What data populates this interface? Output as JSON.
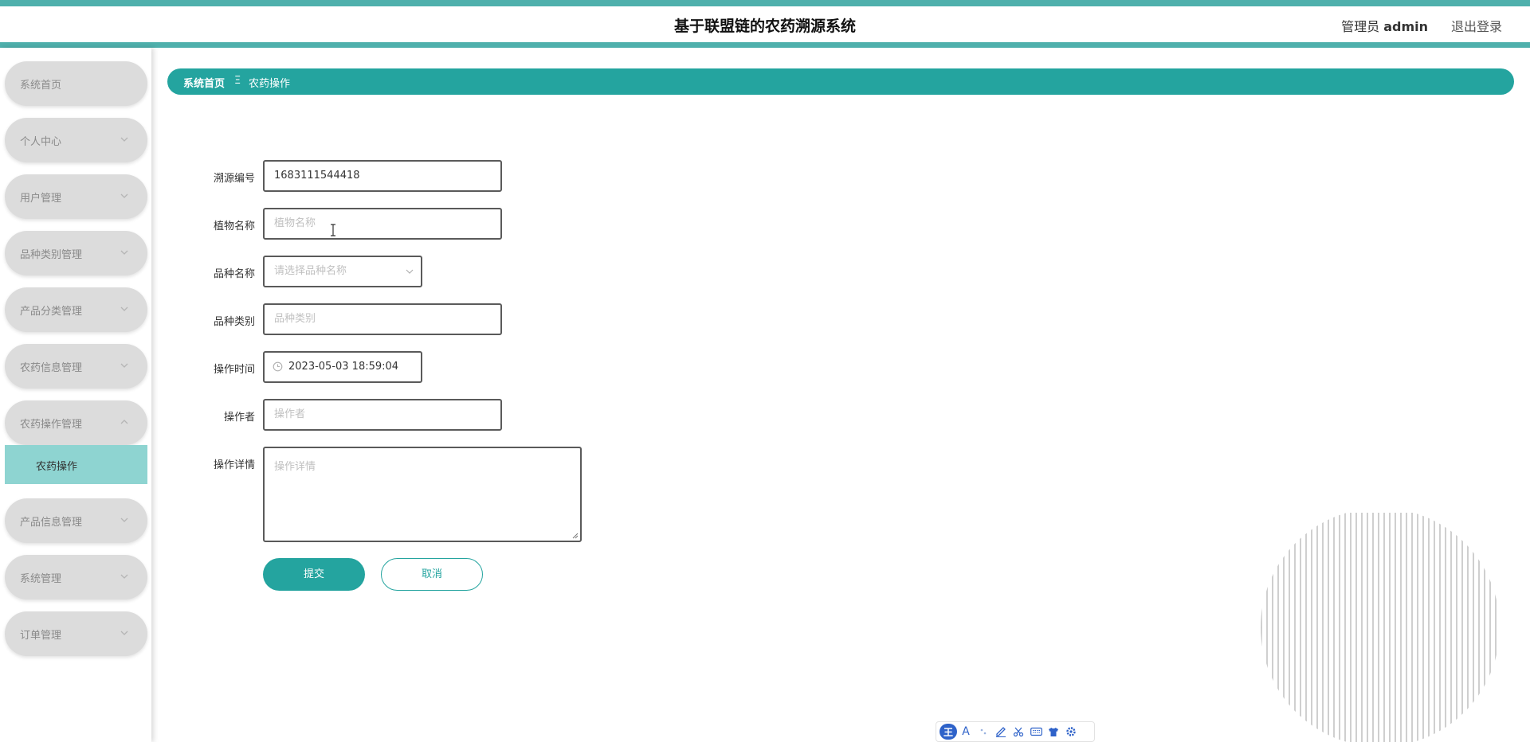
{
  "header": {
    "title": "基于联盟链的农药溯源系统",
    "role_label": "管理员",
    "username": "admin",
    "logout_label": "退出登录"
  },
  "sidebar": {
    "items": [
      {
        "label": "系统首页",
        "has_chevron": false
      },
      {
        "label": "个人中心",
        "has_chevron": true
      },
      {
        "label": "用户管理",
        "has_chevron": true
      },
      {
        "label": "品种类别管理",
        "has_chevron": true
      },
      {
        "label": "产品分类管理",
        "has_chevron": true
      },
      {
        "label": "农药信息管理",
        "has_chevron": true
      },
      {
        "label": "农药操作管理",
        "has_chevron": true,
        "expanded": true
      },
      {
        "label": "产品信息管理",
        "has_chevron": true
      },
      {
        "label": "系统管理",
        "has_chevron": true
      },
      {
        "label": "订单管理",
        "has_chevron": true
      }
    ],
    "subitem": {
      "label": "农药操作"
    }
  },
  "breadcrumb": {
    "home": "系统首页",
    "separator": "Ξ",
    "current": "农药操作"
  },
  "form": {
    "trace_no": {
      "label": "溯源编号",
      "value": "1683111544418"
    },
    "plant_name": {
      "label": "植物名称",
      "placeholder": "植物名称"
    },
    "variety_name": {
      "label": "品种名称",
      "placeholder": "请选择品种名称"
    },
    "variety_category": {
      "label": "品种类别",
      "placeholder": "品种类别"
    },
    "operate_time": {
      "label": "操作时间",
      "value": "2023-05-03 18:59:04"
    },
    "operator": {
      "label": "操作者",
      "placeholder": "操作者"
    },
    "details": {
      "label": "操作详情",
      "placeholder": "操作详情"
    },
    "submit_label": "提交",
    "cancel_label": "取消"
  },
  "ime_toolbar": {
    "logo": "王",
    "font_glyph": "A"
  },
  "colors": {
    "accent": "#24a49f",
    "header_stripe": "#4fb0ac",
    "submenu_active": "#8ed4d1",
    "menu_pill": "#dcdcdc"
  }
}
